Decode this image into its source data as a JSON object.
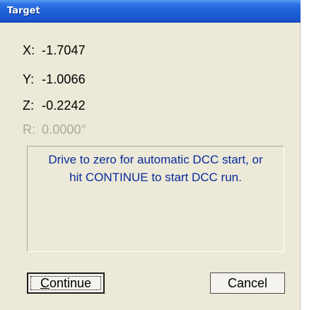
{
  "window": {
    "title": "Target"
  },
  "coordinates": {
    "x": {
      "label": "X:",
      "value": "-1.7047"
    },
    "y": {
      "label": "Y:",
      "value": "-1.0066"
    },
    "z": {
      "label": "Z:",
      "value": "-0.2242"
    },
    "r": {
      "label": "R:",
      "value": "0.0000°",
      "enabled": false
    }
  },
  "message": {
    "line1": "Drive to zero for automatic DCC start, or",
    "line2": "hit CONTINUE to start DCC run."
  },
  "buttons": {
    "continue_first": "C",
    "continue_rest": "ontinue",
    "cancel_label": "Cancel"
  },
  "colors": {
    "titlebar": "#2e74e4",
    "dialog_background": "#ece9d8",
    "message_text": "#0a2a9c",
    "disabled_text": "#aca899"
  }
}
